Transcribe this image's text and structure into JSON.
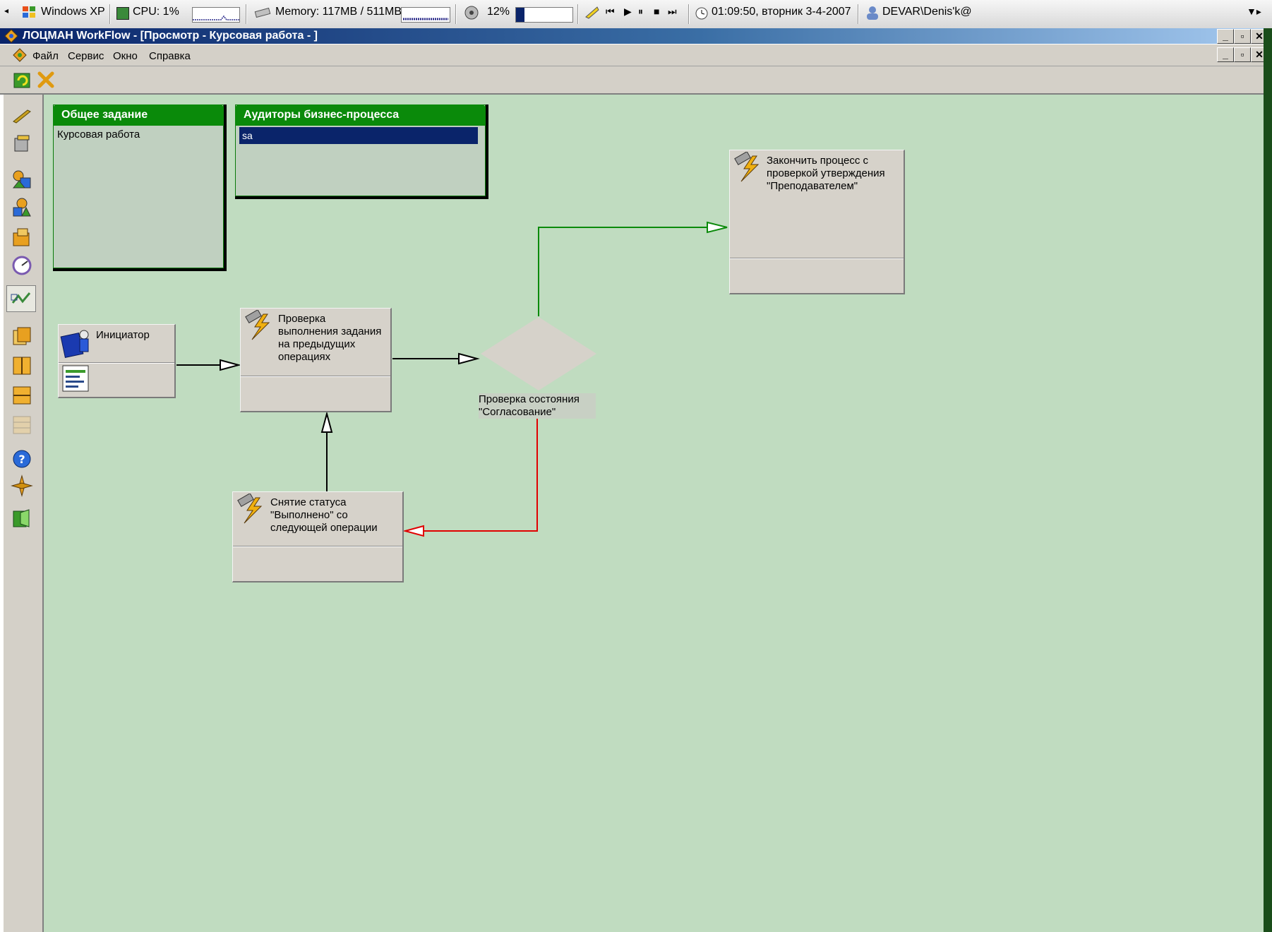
{
  "statusbar": {
    "os": "Windows XP",
    "cpu": "CPU: 1%",
    "memory": "Memory: 117MB / 511MB",
    "volume": "12%",
    "datetime": "01:09:50, вторник 3-4-2007",
    "user": "DEVAR\\Denis'k@"
  },
  "window": {
    "title": "ЛОЦМАН WorkFlow - [Просмотр - Курсовая работа - ]"
  },
  "menu": {
    "items": [
      "Файл",
      "Сервис",
      "Окно",
      "Справка"
    ]
  },
  "panels": {
    "task": {
      "title": "Общее задание",
      "body": "Курсовая работа"
    },
    "auditors": {
      "title": "Аудиторы бизнес-процесса",
      "selected": "sa"
    }
  },
  "nodes": {
    "initiator": {
      "label": "Инициатор"
    },
    "check_previous": {
      "label": "Проверка выполнения задания на предыдущих операциях"
    },
    "decision": {
      "label": "Проверка состояния \"Согласование\""
    },
    "finish": {
      "label": "Закончить процесс с проверкой утверждения \"Преподавателем\""
    },
    "remove_status": {
      "label": "Снятие статуса \"Выполнено\" со следующей операции"
    }
  },
  "colors": {
    "canvas": "#c0dcc0",
    "panel_header": "#0a8a0a",
    "edge_yes": "#0a8a0a",
    "edge_no": "#e00000",
    "selection": "#0a246a"
  },
  "icons": {
    "os": "windows-flag-icon",
    "task": "lightning-task-icon",
    "initiator": "person-book-icon"
  }
}
